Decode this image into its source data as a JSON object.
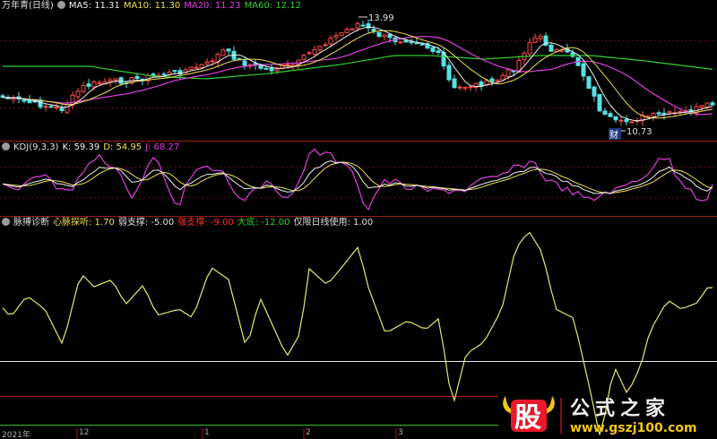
{
  "colors": {
    "background": "#000000",
    "panel_separator": "#9b1b1b",
    "gridline": "#7a1414",
    "up_candle": "#ff4a4a",
    "down_candle": "#54e3e3",
    "ma5": "#f0f0f0",
    "ma10": "#f0e050",
    "ma20": "#e040e0",
    "ma60": "#30d030",
    "kdj_k": "#f0f0f0",
    "kdj_d": "#f0e050",
    "kdj_j": "#e040e0",
    "pulse": "#e8e870",
    "line_1_70": "#e8e8e8",
    "line_minus5": "#9b1b1b",
    "line_minus12": "#30c030",
    "logo_red": "#e8192c",
    "logo_gold": "#f5c518"
  },
  "main_panel": {
    "title": "万年青(日线)",
    "indicators": [
      {
        "label": "MA5: 11.31",
        "color": "#f0f0f0"
      },
      {
        "label": "MA10: 11.30",
        "color": "#f0e050"
      },
      {
        "label": "MA20: 11.23",
        "color": "#e040e0"
      },
      {
        "label": "MA60: 12.12",
        "color": "#30d030"
      }
    ],
    "high_label": "13.99",
    "low_label": "10.73",
    "low_marker": "财"
  },
  "kdj_panel": {
    "title": "KDJ(9,3,3)",
    "values": [
      {
        "label": "K: 59.39",
        "color": "#f0f0f0"
      },
      {
        "label": "D: 54.95",
        "color": "#f0e050"
      },
      {
        "label": "J: 68.27",
        "color": "#e040e0"
      }
    ]
  },
  "pulse_panel": {
    "title": "脉搏诊断",
    "values": [
      {
        "label": "心脉探听: 1.70",
        "color": "#f0e050"
      },
      {
        "label": "弱支撑: -5.00",
        "color": "#e0e0e0"
      },
      {
        "label": "强支撑: -9.00",
        "color": "#ff3030"
      },
      {
        "label": "大底: -12.00",
        "color": "#30d030"
      },
      {
        "label": "仅限日线使用: 1.00",
        "color": "#e0e0e0"
      }
    ]
  },
  "date_axis": [
    "2021年",
    "12",
    "1",
    "2",
    "3"
  ],
  "watermark": {
    "badge": "股",
    "name": "公式之家",
    "url": "www.gszj100.com"
  }
}
